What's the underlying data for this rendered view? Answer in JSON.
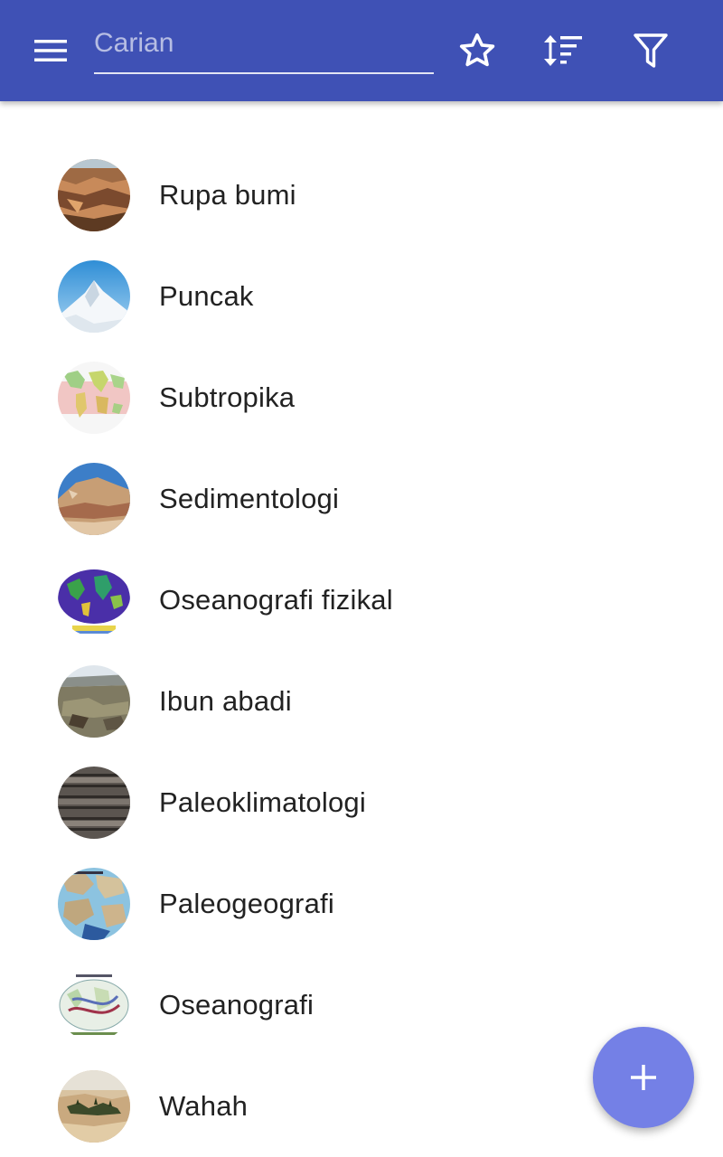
{
  "toolbar": {
    "menu_icon": "menu-icon",
    "search_placeholder": "Carian",
    "search_value": "",
    "favorite_icon": "star-outline-icon",
    "sort_icon": "sort-icon",
    "filter_icon": "filter-icon",
    "background_color": "#3f51b5"
  },
  "list": {
    "items": [
      {
        "label": "Rupa bumi"
      },
      {
        "label": "Puncak"
      },
      {
        "label": "Subtropika"
      },
      {
        "label": "Sedimentologi"
      },
      {
        "label": "Oseanografi fizikal"
      },
      {
        "label": "Ibun abadi"
      },
      {
        "label": "Paleoklimatologi"
      },
      {
        "label": "Paleogeografi"
      },
      {
        "label": "Oseanografi"
      },
      {
        "label": "Wahah"
      }
    ]
  },
  "fab": {
    "icon": "plus-icon",
    "color": "#7480e6"
  }
}
